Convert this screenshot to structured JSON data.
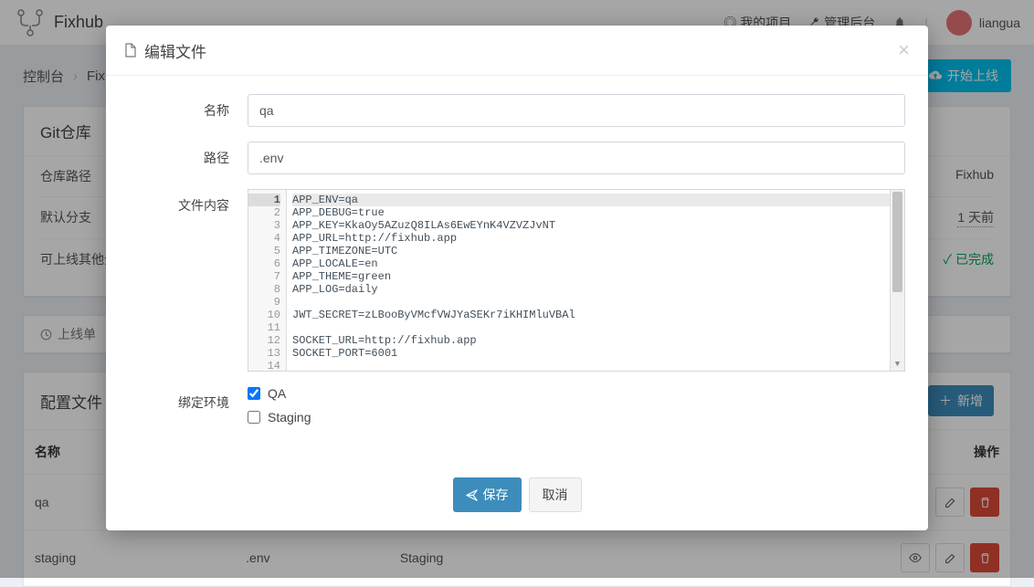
{
  "app": {
    "name": "Fixhub"
  },
  "topnav": {
    "my_projects": "我的项目",
    "admin": "管理后台",
    "username": "liangua"
  },
  "breadcrumb": {
    "console": "控制台",
    "project": "Fixhu"
  },
  "deploy_button": "开始上线",
  "git_panel": {
    "title": "Git仓库",
    "rows": {
      "repo_path_label": "仓库路径",
      "repo_path_val": "Fixhub",
      "default_branch_label": "默认分支",
      "default_branch_val": "1 天前",
      "other_branch_label": "可上线其他分支",
      "other_branch_val": "已完成"
    }
  },
  "tabs": {
    "deploys": "上线单"
  },
  "files_panel": {
    "title": "配置文件",
    "add": "新增",
    "cols": {
      "name": "名称",
      "path": "",
      "env": "",
      "actions": "操作"
    },
    "rows": [
      {
        "name": "qa",
        "path": "",
        "env": ""
      },
      {
        "name": "staging",
        "path": ".env",
        "env": "Staging"
      }
    ]
  },
  "modal": {
    "title": "编辑文件",
    "labels": {
      "name": "名称",
      "path": "路径",
      "content": "文件内容",
      "bind_env": "绑定环境"
    },
    "name_value": "qa",
    "path_value": ".env",
    "code_lines": [
      "APP_ENV=qa",
      "APP_DEBUG=true",
      "APP_KEY=KkaOy5AZuzQ8ILAs6EwEYnK4VZVZJvNT",
      "APP_URL=http://fixhub.app",
      "APP_TIMEZONE=UTC",
      "APP_LOCALE=en",
      "APP_THEME=green",
      "APP_LOG=daily",
      "",
      "JWT_SECRET=zLBooByVMcfVWJYaSEKr7iKHIMluVBAl",
      "",
      "SOCKET_URL=http://fixhub.app",
      "SOCKET_PORT=6001",
      ""
    ],
    "envs": [
      {
        "label": "QA",
        "checked": true
      },
      {
        "label": "Staging",
        "checked": false
      }
    ],
    "save": "保存",
    "cancel": "取消"
  }
}
